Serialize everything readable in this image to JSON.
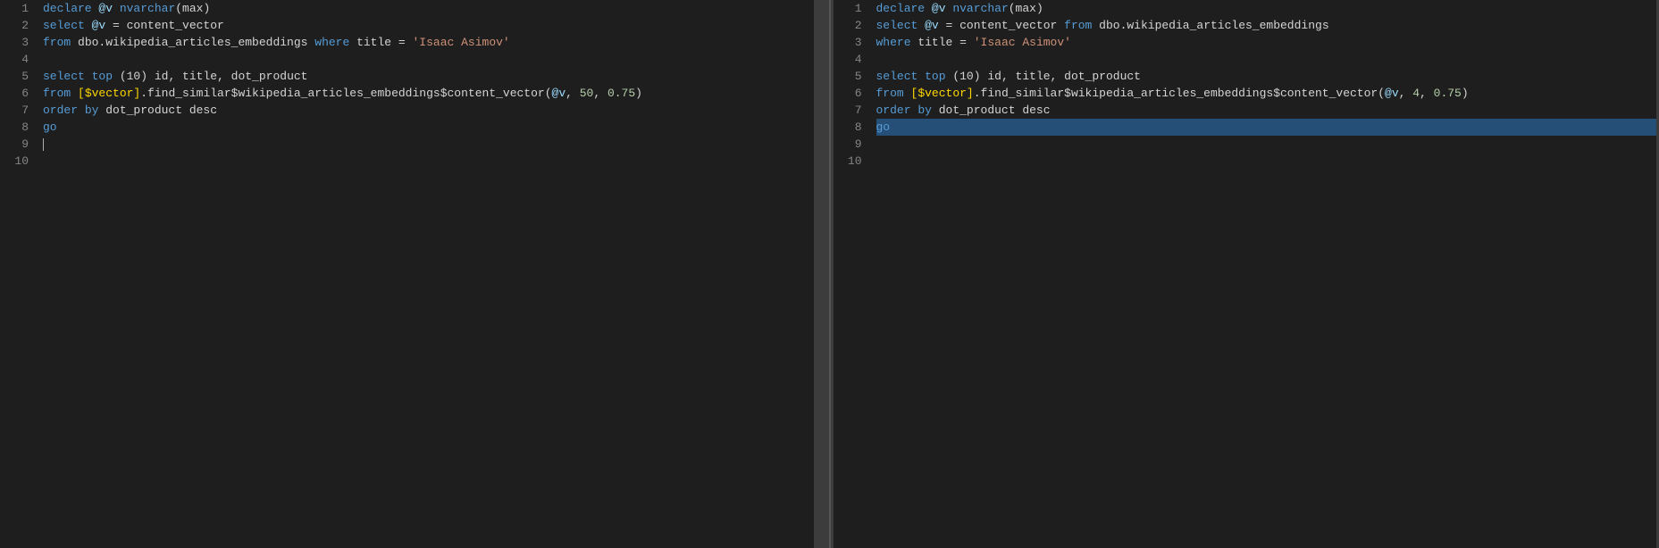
{
  "left_pane": {
    "lines": [
      {
        "n": 1,
        "tokens": [
          {
            "t": "declare ",
            "c": "kw"
          },
          {
            "t": "@v",
            "c": "var"
          },
          {
            "t": " nvarchar",
            "c": "kw"
          },
          {
            "t": "(max)",
            "c": "plain"
          }
        ]
      },
      {
        "n": 2,
        "tokens": [
          {
            "t": "select ",
            "c": "kw"
          },
          {
            "t": "@v",
            "c": "var"
          },
          {
            "t": " = content_vector",
            "c": "plain"
          }
        ]
      },
      {
        "n": 3,
        "tokens": [
          {
            "t": "from ",
            "c": "kw"
          },
          {
            "t": "dbo.wikipedia_articles_embeddings ",
            "c": "plain"
          },
          {
            "t": "where ",
            "c": "kw"
          },
          {
            "t": "title",
            "c": "plain"
          },
          {
            "t": " = ",
            "c": "plain"
          },
          {
            "t": "'Isaac Asimov'",
            "c": "str"
          }
        ]
      },
      {
        "n": 4,
        "tokens": []
      },
      {
        "n": 5,
        "tokens": [
          {
            "t": "select ",
            "c": "kw"
          },
          {
            "t": "top ",
            "c": "kw"
          },
          {
            "t": "(10) ",
            "c": "plain"
          },
          {
            "t": "id, title, dot_product",
            "c": "plain"
          }
        ]
      },
      {
        "n": 6,
        "tokens": [
          {
            "t": "from ",
            "c": "kw"
          },
          {
            "t": "[$vector]",
            "c": "bracket"
          },
          {
            "t": ".find_similar$wikipedia_articles_embeddings$content_vector(",
            "c": "plain"
          },
          {
            "t": "@v",
            "c": "var"
          },
          {
            "t": ", ",
            "c": "plain"
          },
          {
            "t": "50",
            "c": "num"
          },
          {
            "t": ", ",
            "c": "plain"
          },
          {
            "t": "0.75",
            "c": "num"
          },
          {
            "t": ")",
            "c": "plain"
          }
        ]
      },
      {
        "n": 7,
        "tokens": [
          {
            "t": "order ",
            "c": "kw"
          },
          {
            "t": "by ",
            "c": "kw"
          },
          {
            "t": "dot_product desc",
            "c": "plain"
          }
        ]
      },
      {
        "n": 8,
        "tokens": [
          {
            "t": "go",
            "c": "kw"
          }
        ]
      },
      {
        "n": 9,
        "tokens": [
          {
            "t": "|",
            "c": "cursor"
          }
        ]
      },
      {
        "n": 10,
        "tokens": []
      }
    ]
  },
  "right_pane": {
    "lines": [
      {
        "n": 1,
        "tokens": [
          {
            "t": "declare ",
            "c": "kw"
          },
          {
            "t": "@v",
            "c": "var"
          },
          {
            "t": " nvarchar",
            "c": "kw"
          },
          {
            "t": "(max)",
            "c": "plain"
          }
        ]
      },
      {
        "n": 2,
        "tokens": [
          {
            "t": "select ",
            "c": "kw"
          },
          {
            "t": "@v",
            "c": "var"
          },
          {
            "t": " = content_vector ",
            "c": "plain"
          },
          {
            "t": "from ",
            "c": "kw"
          },
          {
            "t": "dbo.wikipedia_articles_embeddings",
            "c": "plain"
          }
        ]
      },
      {
        "n": 3,
        "tokens": [
          {
            "t": "where ",
            "c": "kw"
          },
          {
            "t": "title",
            "c": "plain"
          },
          {
            "t": " = ",
            "c": "plain"
          },
          {
            "t": "'Isaac Asimov'",
            "c": "str"
          }
        ]
      },
      {
        "n": 4,
        "tokens": []
      },
      {
        "n": 5,
        "tokens": [
          {
            "t": "select ",
            "c": "kw"
          },
          {
            "t": "top ",
            "c": "kw"
          },
          {
            "t": "(10) ",
            "c": "plain"
          },
          {
            "t": "id, title, dot_product",
            "c": "plain"
          }
        ]
      },
      {
        "n": 6,
        "tokens": [
          {
            "t": "from ",
            "c": "kw"
          },
          {
            "t": "[$vector]",
            "c": "bracket"
          },
          {
            "t": ".find_similar$wikipedia_articles_embeddings$content_vector(",
            "c": "plain"
          },
          {
            "t": "@v",
            "c": "var"
          },
          {
            "t": ", ",
            "c": "plain"
          },
          {
            "t": "4",
            "c": "num"
          },
          {
            "t": ", ",
            "c": "plain"
          },
          {
            "t": "0.75",
            "c": "num"
          },
          {
            "t": ")",
            "c": "plain"
          }
        ]
      },
      {
        "n": 7,
        "tokens": [
          {
            "t": "order ",
            "c": "kw"
          },
          {
            "t": "by ",
            "c": "kw"
          },
          {
            "t": "dot_product desc",
            "c": "plain"
          }
        ]
      },
      {
        "n": 8,
        "tokens": [
          {
            "t": "go",
            "c": "kw",
            "highlight": true
          }
        ]
      },
      {
        "n": 9,
        "tokens": []
      },
      {
        "n": 10,
        "tokens": []
      }
    ]
  }
}
